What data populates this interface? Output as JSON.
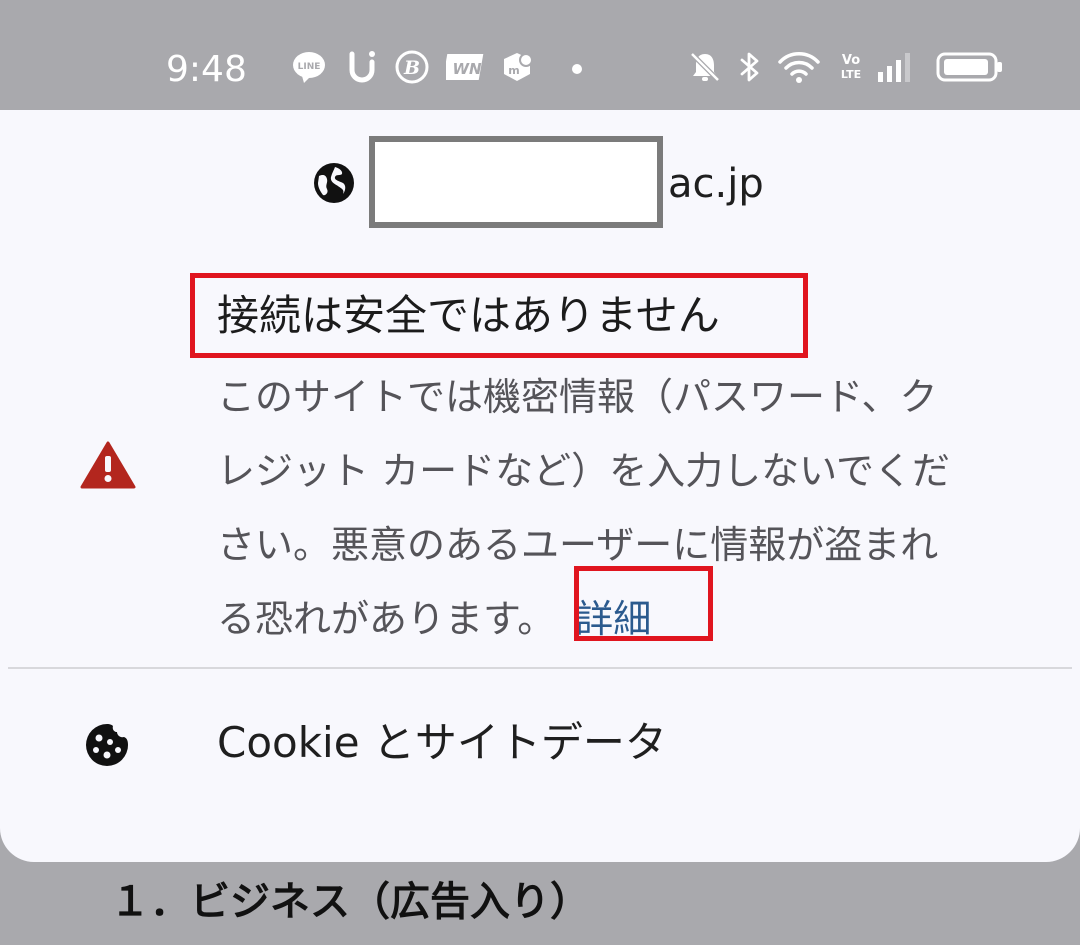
{
  "status_bar": {
    "time": "9:48",
    "left_icons": [
      "line-icon",
      "u-app-icon",
      "b-app-icon",
      "wn-app-icon",
      "m-app-icon",
      "dot-icon"
    ],
    "right_icons": [
      "bell-off-icon",
      "bluetooth-icon",
      "wifi-icon",
      "volte-icon",
      "signal-icon",
      "battery-icon"
    ],
    "volte_text": "Vo\nLTE"
  },
  "site_info": {
    "domain_suffix": "ac.jp",
    "security": {
      "title": "接続は安全ではありません",
      "description_lines": [
        "このサイトでは機密情報（パスワード、ク",
        "レジット カードなど）を入力しないでくだ",
        "さい。悪意のあるユーザーに情報が盗まれ",
        "る恐れがあります。"
      ],
      "details_link": "詳細"
    },
    "cookies_label": "Cookie とサイトデータ"
  },
  "background_page": {
    "heading": "１．ビジネス（広告入り）"
  },
  "colors": {
    "highlight": "#e0151f",
    "warning": "#b3261e",
    "link": "#2b5a8e",
    "sheet_bg": "#f8f8fd",
    "status_bg": "#a9a9ad"
  }
}
